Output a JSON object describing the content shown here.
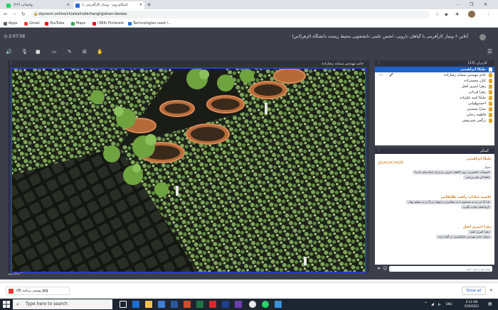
{
  "browser": {
    "tabs": [
      {
        "label": "(۲۶) واتساپ"
      },
      {
        "label": "اسکای‌روم - وبینار کارآفرینی با"
      }
    ],
    "new_tab": "+",
    "window_controls": [
      "–",
      "❐",
      "✕"
    ],
    "url": "skyroom.online/ch/alzahrafarhangi/giahan-daroee",
    "bookmarks": [
      {
        "label": "Apps",
        "color": "#5f6368"
      },
      {
        "label": "Gmail",
        "color": "#ea4335"
      },
      {
        "label": "YouTube",
        "color": "#ff0000"
      },
      {
        "label": "Maps",
        "color": "#34a853"
      },
      {
        "label": "(384) Pinterest",
        "color": "#e60023"
      },
      {
        "label": "Technologies used i...",
        "color": "#2a6fdb"
      }
    ]
  },
  "app": {
    "timer": "2:07:56",
    "title": "آنلاین ۶ وبینار کارآفرینی با گیاهان دارویی- انجمن علمی دانشجویی محیط زیست دانشگاه الزهرا(س)",
    "stage_label": "خانم مهندس سمانه رضازاده",
    "logo_text": "اسکای‌روم™",
    "users_header": "کاربران (23)",
    "users": [
      {
        "name": "ملیکا ابراهیمی",
        "selected": true
      },
      {
        "name": "خانم مهندس سمانه رضازاده",
        "selected": false
      },
      {
        "name": "کیان محمدزاده",
        "selected": false
      },
      {
        "name": "زهرا امیری اصل",
        "selected": false
      },
      {
        "name": "زهرا قربانی",
        "selected": false
      },
      {
        "name": "ملیکا اسد علیزاده",
        "selected": false
      },
      {
        "name": "احمدپهلوانی",
        "selected": false
      },
      {
        "name": "سارا محمدی",
        "selected": false
      },
      {
        "name": "فاطمه رجایی",
        "selected": false
      },
      {
        "name": "نرگس شیرنوش",
        "selected": false
      }
    ],
    "chat": {
      "header": "گفتگو",
      "messages": [
        {
          "sender": "ملیکا ابراهیمی",
          "mention": "@SAGHI.FAIZE",
          "text": "سوال:",
          "bubbles": [
            "کمبودآب کشاورزی روی گیاهان دارویی تو ایران اصلا پیامد داره؟",
            "لطفا این هم بررسی"
          ]
        },
        {
          "sender": "عاشیه سادات راهب طلیقانی",
          "text": "",
          "bubbles": [
            "بله آیا این تو به مستقیم یا به میکانیزم درختهای بزرگ و نه تنظیم نهال",
            "کرمانشاه جواب بگیرند"
          ]
        },
        {
          "sender": "زهرا امیری اصل",
          "text": "",
          "bubbles": [
            "زهرا امیری اصل",
            "سوال خانم مهندس حاصلخیزی در گیاه زنده"
          ]
        }
      ],
      "input_placeholder": "پیام خود را وارد کنید"
    }
  },
  "downloads": {
    "file": "پوستر برنامه (8).jpg",
    "show_all": "Show all"
  },
  "taskbar": {
    "search_placeholder": "Type here to search",
    "time": "6:12 AM",
    "date": "5/19/2021",
    "lang": "ENG"
  }
}
